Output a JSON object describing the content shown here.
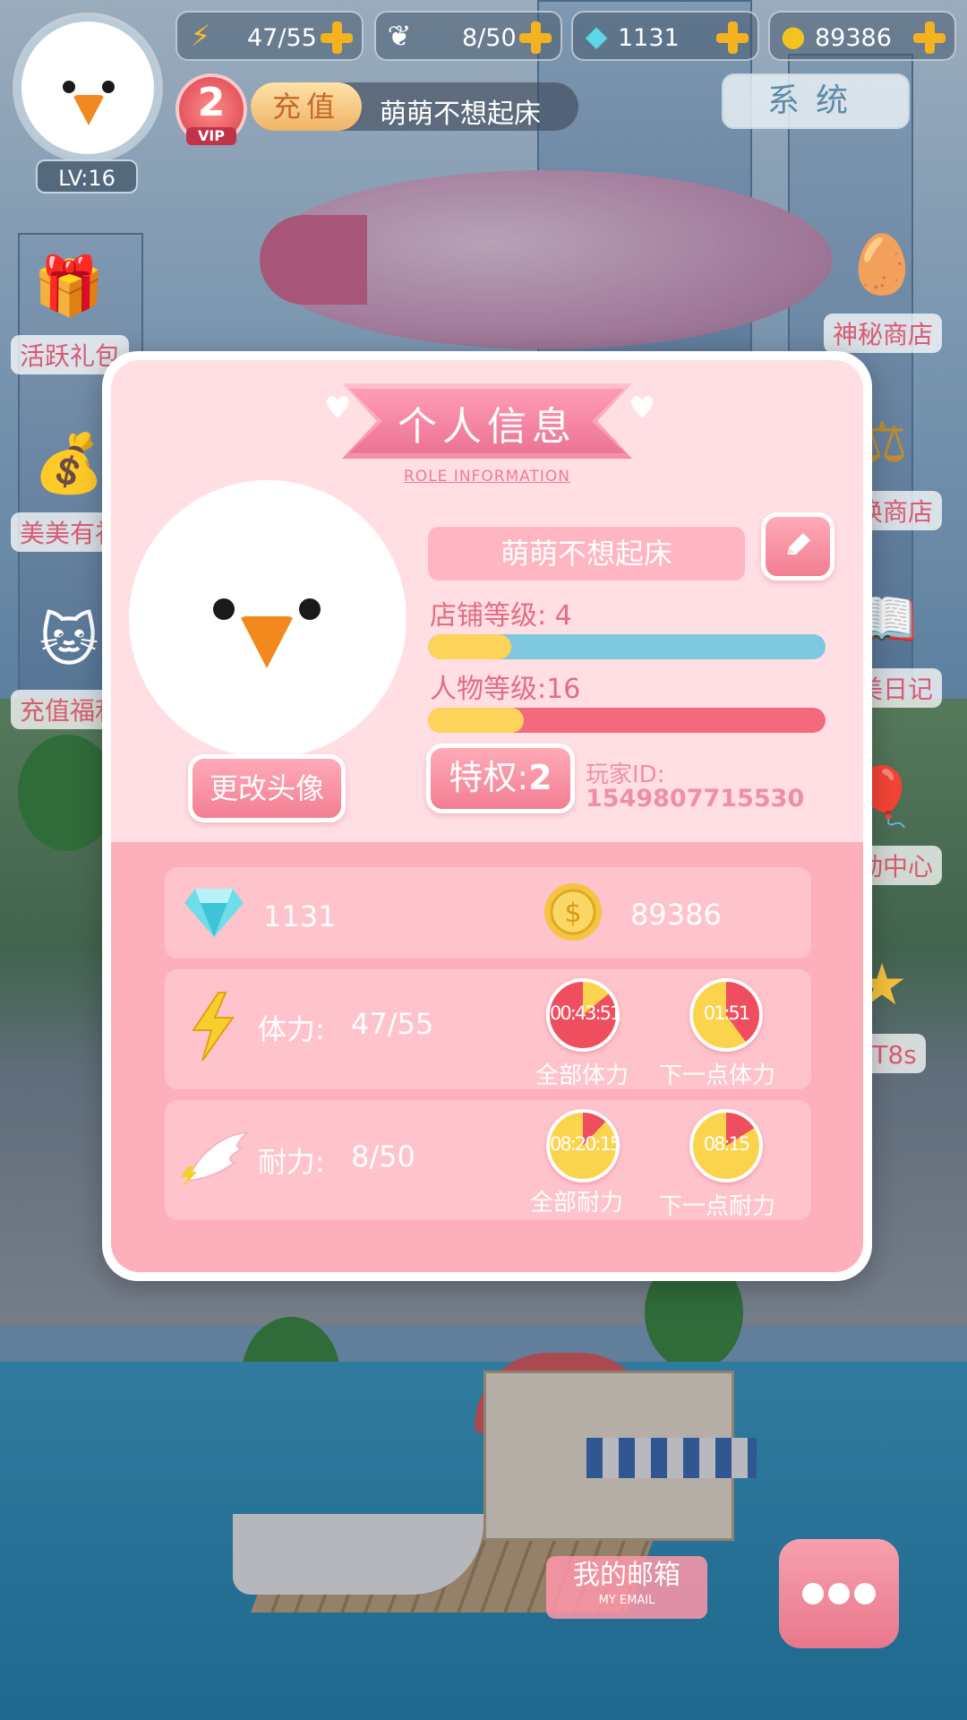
{
  "hud": {
    "level": "LV:16",
    "vip_level": "2",
    "vip_label": "VIP",
    "stamina": "47/55",
    "endurance": "8/50",
    "diamonds": "1131",
    "coins": "89386",
    "topup_label": "充值",
    "player_name": "萌萌不想起床",
    "system_label": "系统"
  },
  "side_menu": {
    "left": [
      {
        "label": "活跃礼包",
        "icon": "gift-box-icon"
      },
      {
        "label": "美美有礼",
        "icon": "lucky-bag-icon"
      },
      {
        "label": "充值福利",
        "icon": "lucky-cat-icon"
      }
    ],
    "right": [
      {
        "label": "神秘商店",
        "icon": "mystery-egg-icon"
      },
      {
        "label": "兑换商店",
        "icon": "scale-icon"
      },
      {
        "label": "甜美日记",
        "icon": "diary-icon"
      },
      {
        "label": "活动中心",
        "icon": "balloon-icon"
      },
      {
        "label": "图T8s",
        "icon": "star-icon"
      }
    ]
  },
  "modal": {
    "title": "个人信息",
    "subtitle": "ROLE INFORMATION",
    "name": "萌萌不想起床",
    "change_avatar_label": "更改头像",
    "shop_level_label": "店铺等级: 4",
    "shop_level_progress": 0.21,
    "char_level_label": "人物等级:16",
    "char_level_progress": 0.24,
    "privilege_label": "特权:",
    "privilege_value": "2",
    "player_id_label": "玩家ID:",
    "player_id": "1549807715530",
    "diamonds": "1131",
    "coins": "89386",
    "stamina_label": "体力:",
    "stamina_value": "47/55",
    "stamina_full_timer": "00:43:51",
    "stamina_full_label": "全部体力",
    "stamina_next_timer": "01:51",
    "stamina_next_label": "下一点体力",
    "endurance_label": "耐力:",
    "endurance_value": "8/50",
    "endurance_full_timer": "08:20:15",
    "endurance_full_label": "全部耐力",
    "endurance_next_timer": "08:15",
    "endurance_next_label": "下一点耐力"
  },
  "bottom": {
    "mail_label": "我的邮箱",
    "mail_sub": "MY EMAIL"
  },
  "colors": {
    "accent": "#f27f93",
    "shop_bar": "#7ec8e0",
    "char_bar": "#f46a7c",
    "bar_fill": "#fdd35a",
    "timer_red": "#ee4e5e",
    "timer_yellow": "#fcd34d"
  }
}
